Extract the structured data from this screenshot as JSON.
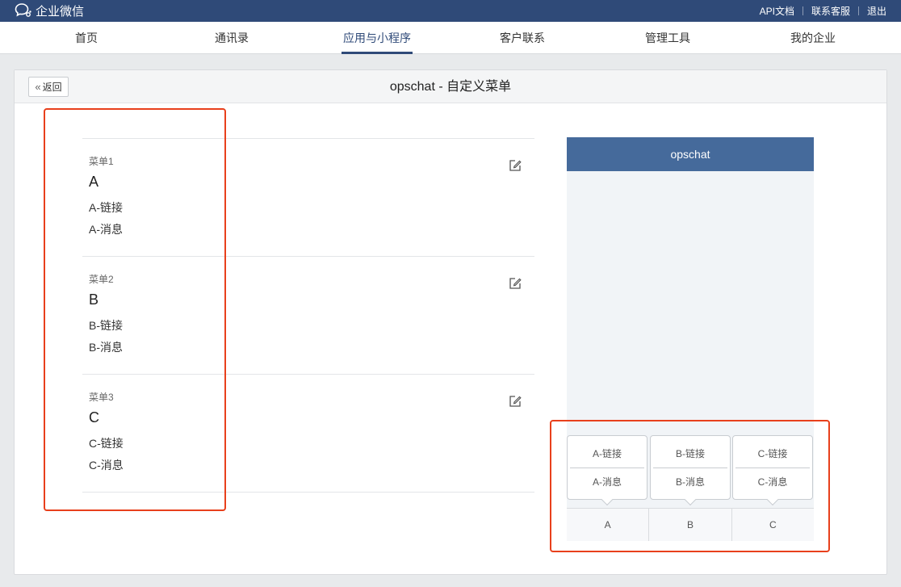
{
  "topbar": {
    "brand": "企业微信",
    "links": [
      "API文档",
      "联系客服",
      "退出"
    ]
  },
  "nav": {
    "tabs": [
      {
        "label": "首页",
        "active": false
      },
      {
        "label": "通讯录",
        "active": false
      },
      {
        "label": "应用与小程序",
        "active": true
      },
      {
        "label": "客户联系",
        "active": false
      },
      {
        "label": "管理工具",
        "active": false
      },
      {
        "label": "我的企业",
        "active": false
      }
    ]
  },
  "panel": {
    "back_label": "返回",
    "title": "opschat - 自定义菜单"
  },
  "menus": [
    {
      "label": "菜单1",
      "name": "A",
      "sub1": "A-链接",
      "sub2": "A-消息"
    },
    {
      "label": "菜单2",
      "name": "B",
      "sub1": "B-链接",
      "sub2": "B-消息"
    },
    {
      "label": "菜单3",
      "name": "C",
      "sub1": "C-链接",
      "sub2": "C-消息"
    }
  ],
  "phone": {
    "title": "opschat",
    "bar": [
      "A",
      "B",
      "C"
    ],
    "popups": [
      [
        "A-链接",
        "A-消息"
      ],
      [
        "B-链接",
        "B-消息"
      ],
      [
        "C-链接",
        "C-消息"
      ]
    ]
  },
  "colors": {
    "topbar": "#2f4a78",
    "phone_header": "#456a9b",
    "highlight": "#e8401c"
  },
  "icons": [
    "chat-bubbles-logo-icon",
    "double-chevron-left-icon",
    "edit-icon"
  ]
}
